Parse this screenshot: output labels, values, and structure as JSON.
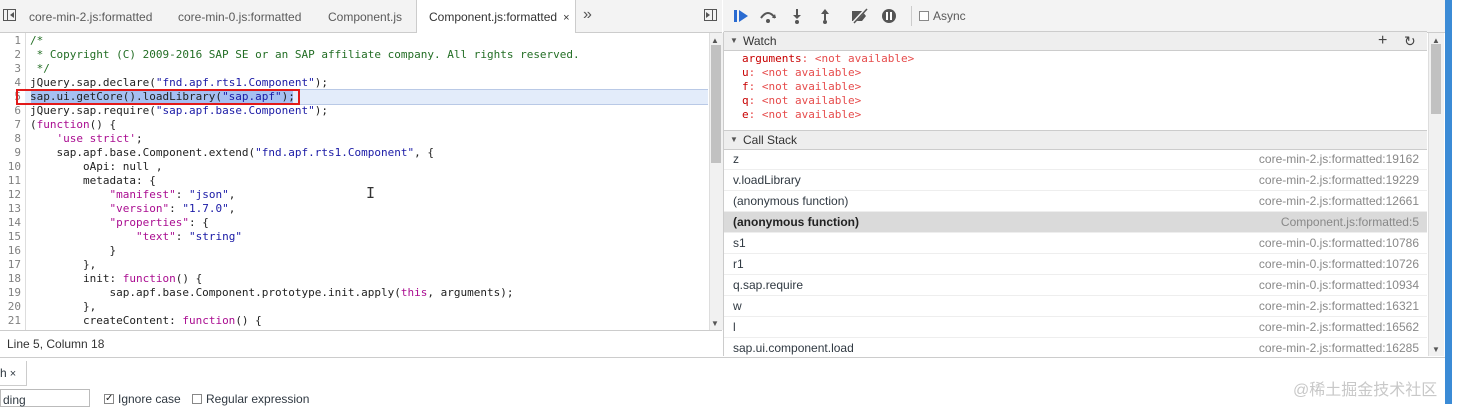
{
  "tabs": [
    {
      "label": "core-min-2.js:formatted",
      "active": false
    },
    {
      "label": "core-min-0.js:formatted",
      "active": false
    },
    {
      "label": "Component.js",
      "active": false
    },
    {
      "label": "Component.js:formatted",
      "active": true
    }
  ],
  "tab_close_glyph": "×",
  "tab_overflow_glyph": "»",
  "code_lines": [
    {
      "n": "1",
      "t": "/*",
      "cls": "c-comment"
    },
    {
      "n": "2",
      "t": " * Copyright (C) 2009-2016 SAP SE or an SAP affiliate company. All rights reserved.",
      "cls": "c-comment"
    },
    {
      "n": "3",
      "t": " */",
      "cls": "c-comment"
    },
    {
      "n": "4",
      "parts": [
        {
          "t": "jQuery.sap.declare(",
          "c": "c-plain"
        },
        {
          "t": "\"fnd.apf.rts1.Component\"",
          "c": "c-str"
        },
        {
          "t": ");",
          "c": "c-plain"
        }
      ]
    },
    {
      "n": "5",
      "parts": [
        {
          "t": "sap.ui.getCore().loadLibrary(",
          "c": "c-plain"
        },
        {
          "t": "\"sap.apf\"",
          "c": "c-str"
        },
        {
          "t": ");",
          "c": "c-plain"
        }
      ]
    },
    {
      "n": "6",
      "parts": [
        {
          "t": "jQuery.sap.require(",
          "c": "c-plain"
        },
        {
          "t": "\"sap.apf.base.Component\"",
          "c": "c-str"
        },
        {
          "t": ");",
          "c": "c-plain"
        }
      ]
    },
    {
      "n": "7",
      "parts": [
        {
          "t": "(",
          "c": "c-plain"
        },
        {
          "t": "function",
          "c": "c-kw"
        },
        {
          "t": "() {",
          "c": "c-plain"
        }
      ]
    },
    {
      "n": "8",
      "parts": [
        {
          "t": "    ",
          "c": "c-plain"
        },
        {
          "t": "'use strict'",
          "c": "c-kw"
        },
        {
          "t": ";",
          "c": "c-plain"
        }
      ]
    },
    {
      "n": "9",
      "parts": [
        {
          "t": "    sap.apf.base.Component.extend(",
          "c": "c-plain"
        },
        {
          "t": "\"fnd.apf.rts1.Component\"",
          "c": "c-str"
        },
        {
          "t": ", {",
          "c": "c-plain"
        }
      ]
    },
    {
      "n": "10",
      "parts": [
        {
          "t": "        oApi: null ,",
          "c": "c-plain"
        }
      ]
    },
    {
      "n": "11",
      "parts": [
        {
          "t": "        metadata: {",
          "c": "c-plain"
        }
      ]
    },
    {
      "n": "12",
      "parts": [
        {
          "t": "            ",
          "c": "c-plain"
        },
        {
          "t": "\"manifest\"",
          "c": "c-kw"
        },
        {
          "t": ": ",
          "c": "c-plain"
        },
        {
          "t": "\"json\"",
          "c": "c-str"
        },
        {
          "t": ",",
          "c": "c-plain"
        }
      ]
    },
    {
      "n": "13",
      "parts": [
        {
          "t": "            ",
          "c": "c-plain"
        },
        {
          "t": "\"version\"",
          "c": "c-kw"
        },
        {
          "t": ": ",
          "c": "c-plain"
        },
        {
          "t": "\"1.7.0\"",
          "c": "c-str"
        },
        {
          "t": ",",
          "c": "c-plain"
        }
      ]
    },
    {
      "n": "14",
      "parts": [
        {
          "t": "            ",
          "c": "c-plain"
        },
        {
          "t": "\"properties\"",
          "c": "c-kw"
        },
        {
          "t": ": {",
          "c": "c-plain"
        }
      ]
    },
    {
      "n": "15",
      "parts": [
        {
          "t": "                ",
          "c": "c-plain"
        },
        {
          "t": "\"text\"",
          "c": "c-kw"
        },
        {
          "t": ": ",
          "c": "c-plain"
        },
        {
          "t": "\"string\"",
          "c": "c-str"
        }
      ]
    },
    {
      "n": "16",
      "parts": [
        {
          "t": "            }",
          "c": "c-plain"
        }
      ]
    },
    {
      "n": "17",
      "parts": [
        {
          "t": "        },",
          "c": "c-plain"
        }
      ]
    },
    {
      "n": "18",
      "parts": [
        {
          "t": "        init: ",
          "c": "c-plain"
        },
        {
          "t": "function",
          "c": "c-kw"
        },
        {
          "t": "() {",
          "c": "c-plain"
        }
      ]
    },
    {
      "n": "19",
      "parts": [
        {
          "t": "            sap.apf.base.Component.prototype.init.apply(",
          "c": "c-plain"
        },
        {
          "t": "this",
          "c": "c-kw"
        },
        {
          "t": ", arguments);",
          "c": "c-plain"
        }
      ]
    },
    {
      "n": "20",
      "parts": [
        {
          "t": "        },",
          "c": "c-plain"
        }
      ]
    },
    {
      "n": "21",
      "parts": [
        {
          "t": "        createContent: ",
          "c": "c-plain"
        },
        {
          "t": "function",
          "c": "c-kw"
        },
        {
          "t": "() {",
          "c": "c-plain"
        }
      ]
    }
  ],
  "status_text": "Line 5, Column 18",
  "debug_toolbar": {
    "async_label": "Async"
  },
  "watch": {
    "title": "Watch",
    "items": [
      {
        "name": "arguments",
        "value": "<not available>"
      },
      {
        "name": "u",
        "value": "<not available>"
      },
      {
        "name": "f",
        "value": "<not available>"
      },
      {
        "name": "q",
        "value": "<not available>"
      },
      {
        "name": "e",
        "value": "<not available>"
      }
    ]
  },
  "call_stack": {
    "title": "Call Stack",
    "frames": [
      {
        "fn": "z",
        "loc": "core-min-2.js:formatted:19162",
        "selected": false
      },
      {
        "fn": "v.loadLibrary",
        "loc": "core-min-2.js:formatted:19229",
        "selected": false
      },
      {
        "fn": "(anonymous function)",
        "loc": "core-min-2.js:formatted:12661",
        "selected": false
      },
      {
        "fn": "(anonymous function)",
        "loc": "Component.js:formatted:5",
        "selected": true
      },
      {
        "fn": "s1",
        "loc": "core-min-0.js:formatted:10786",
        "selected": false
      },
      {
        "fn": "r1",
        "loc": "core-min-0.js:formatted:10726",
        "selected": false
      },
      {
        "fn": "q.sap.require",
        "loc": "core-min-0.js:formatted:10934",
        "selected": false
      },
      {
        "fn": "w",
        "loc": "core-min-2.js:formatted:16321",
        "selected": false
      },
      {
        "fn": "l",
        "loc": "core-min-2.js:formatted:16562",
        "selected": false
      },
      {
        "fn": "sap.ui.component.load",
        "loc": "core-min-2.js:formatted:16285",
        "selected": false
      }
    ]
  },
  "bottom": {
    "search_tab_label": "h",
    "search_value": "ding",
    "ignore_case_label": "Ignore case",
    "ignore_case_checked": true,
    "regex_label": "Regular expression",
    "regex_checked": false
  },
  "watermark": "@稀土掘金技术社区"
}
